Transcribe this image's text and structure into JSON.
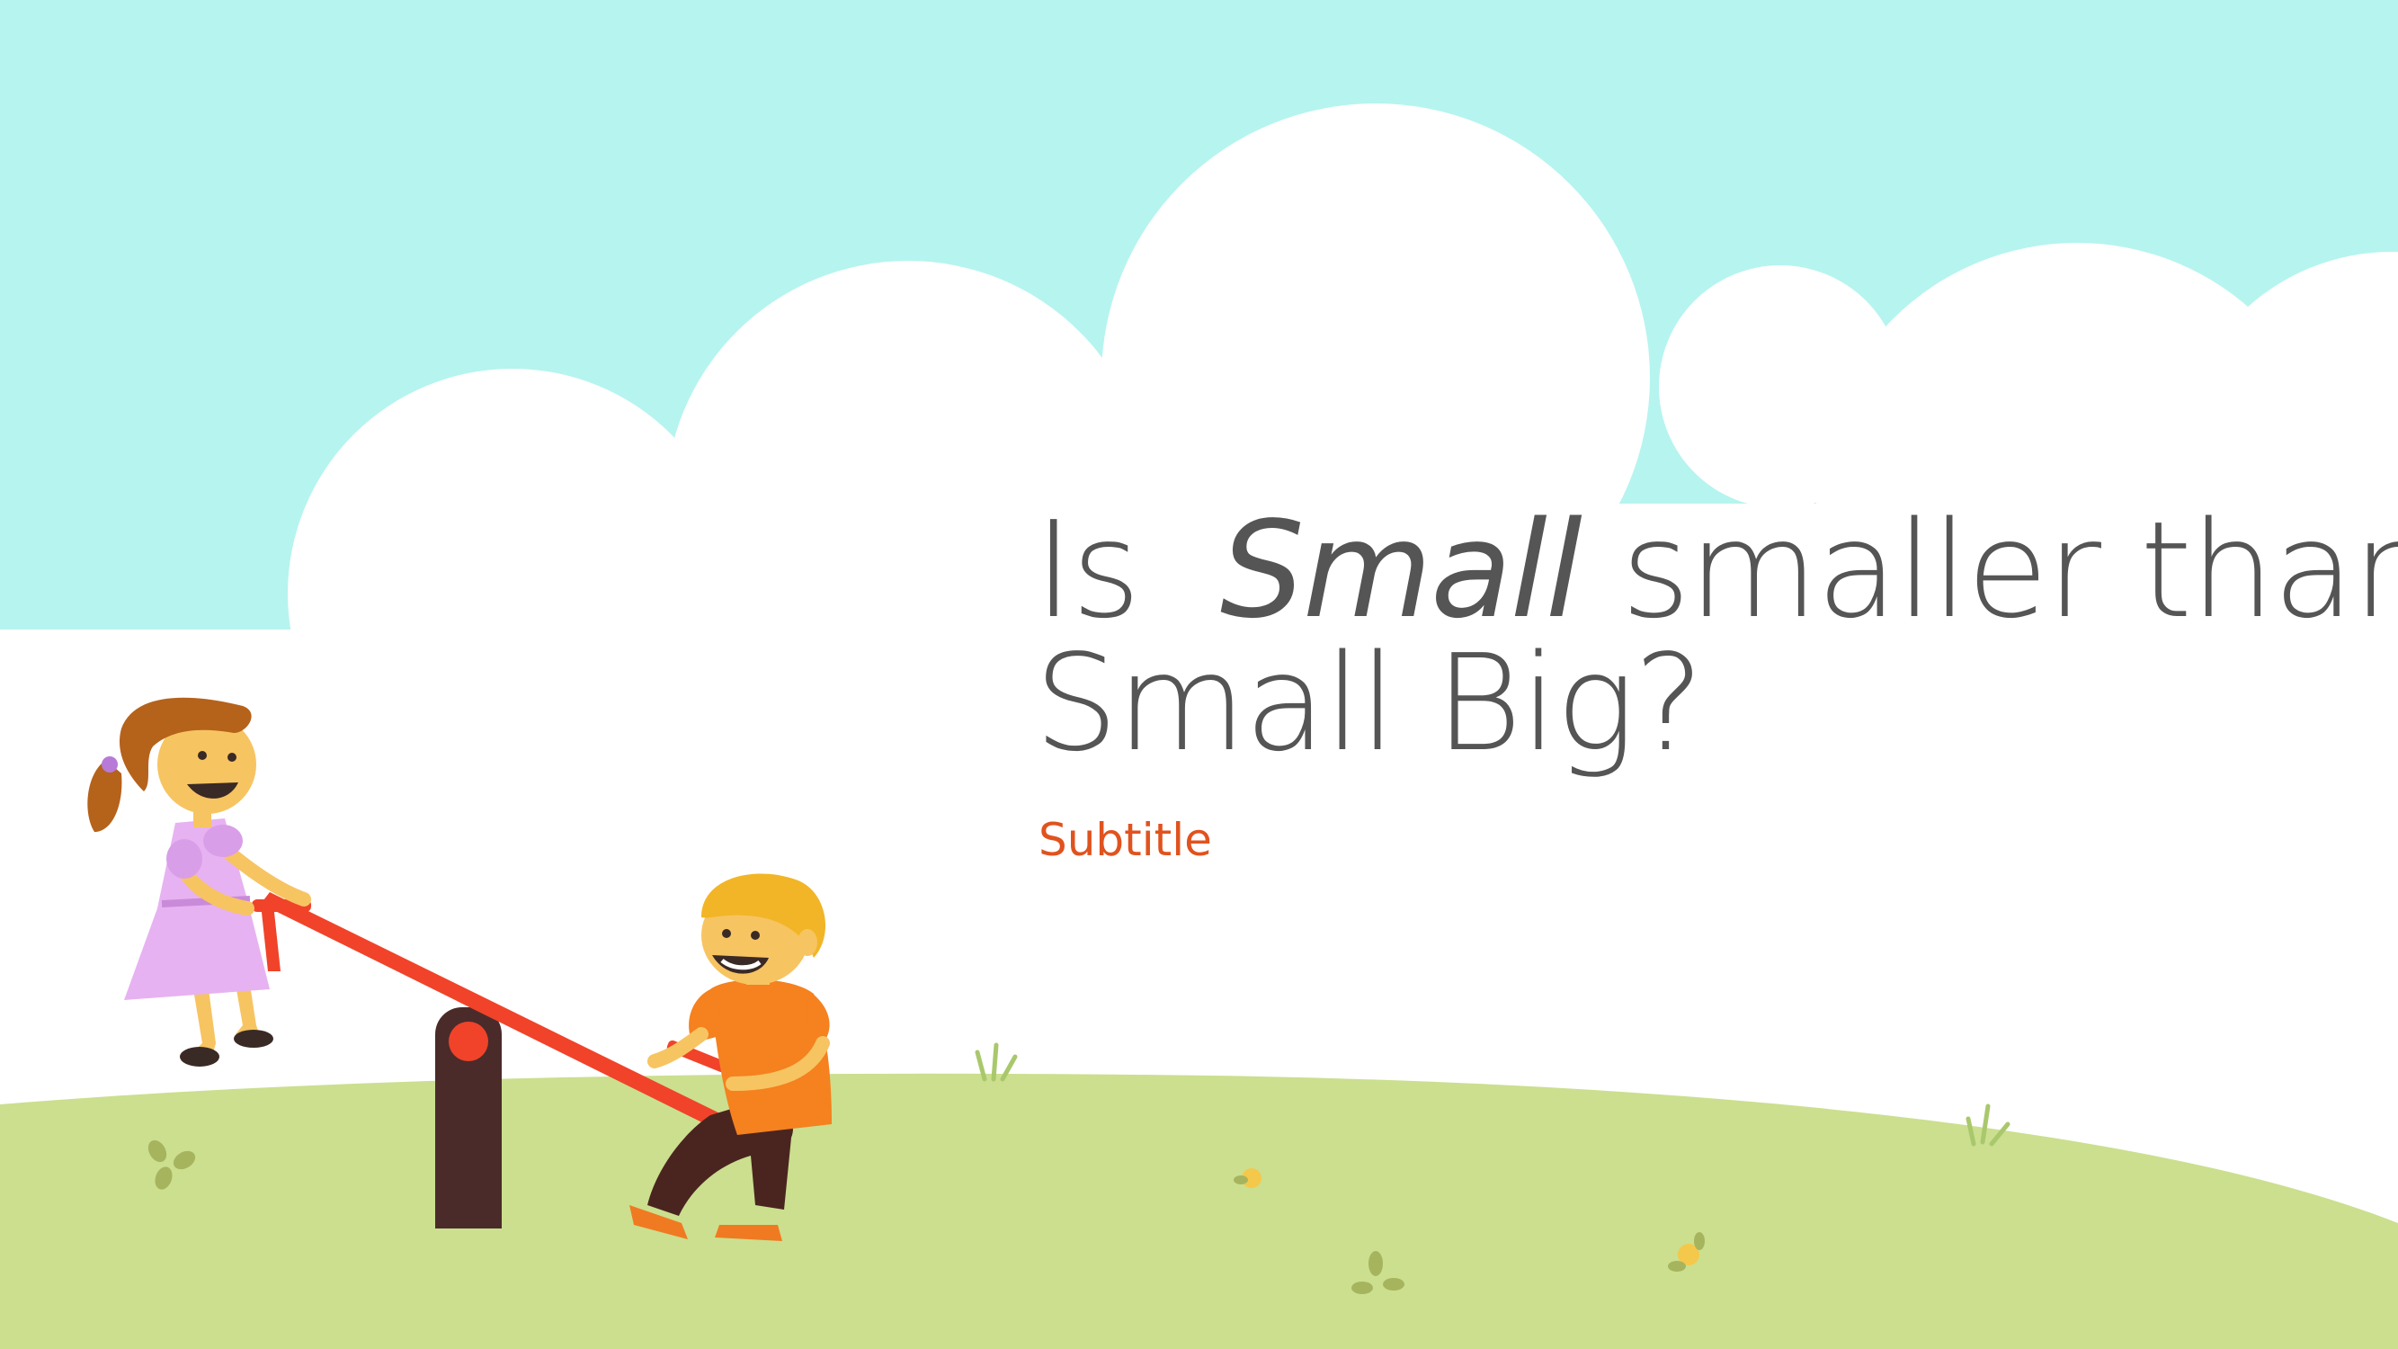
{
  "slide": {
    "title_word_1": "Is",
    "title_word_italic": "Small",
    "title_word_2": "smaller than",
    "title_line_2": "Small Big?",
    "subtitle": "Subtitle"
  },
  "colors": {
    "sky": "#b6f4ef",
    "cloud": "#ffffff",
    "grass": "#cbdf8f",
    "title": "#555555",
    "subtitle": "#e0531e",
    "seesaw": "#f0432a",
    "post": "#4a2b2a"
  },
  "illustration": {
    "icons": [
      "cloud",
      "girl-on-seesaw",
      "boy-on-seesaw",
      "seesaw",
      "grass-tufts",
      "flowers"
    ]
  }
}
